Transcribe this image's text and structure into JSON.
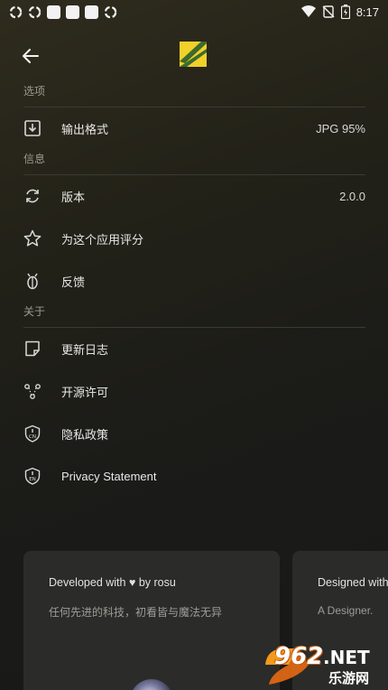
{
  "status_bar": {
    "time": "8:17",
    "left_icons": [
      "sync-icon",
      "sync-icon",
      "app-notification-icon",
      "app-notification-icon",
      "app-notification-icon",
      "sync-icon"
    ],
    "right_icons": [
      "wifi-icon",
      "no-sim-icon",
      "battery-icon"
    ]
  },
  "toolbar": {
    "back_icon": "arrow-left-icon",
    "logo_icon": "app-logo-icon"
  },
  "sections": {
    "options": "选项",
    "info": "信息",
    "about": "关于"
  },
  "rows": {
    "output_format": {
      "label": "输出格式",
      "value": "JPG 95%",
      "icon": "download-box-icon"
    },
    "version": {
      "label": "版本",
      "value": "2.0.0",
      "icon": "refresh-icon"
    },
    "rate_app": {
      "label": "为这个应用评分",
      "icon": "star-icon"
    },
    "feedback": {
      "label": "反馈",
      "icon": "bug-icon"
    },
    "changelog": {
      "label": "更新日志",
      "icon": "note-icon"
    },
    "open_source": {
      "label": "开源许可",
      "icon": "nodes-icon"
    },
    "privacy_cn": {
      "label": "隐私政策",
      "icon": "shield-cn-icon",
      "badge": "CN"
    },
    "privacy_en": {
      "label": "Privacy Statement",
      "icon": "shield-en-icon",
      "badge": "EN"
    }
  },
  "cards": [
    {
      "title": "Developed with ♥ by rosu",
      "subtitle": "任何先进的科技，初看皆与魔法无异"
    },
    {
      "title": "Designed with",
      "subtitle": "A Designer."
    }
  ],
  "watermark": {
    "brand": "962",
    "suffix": ".NET",
    "sub": "乐游网"
  },
  "colors": {
    "accent": "#f2d02a",
    "logo_green": "#3c6b2e",
    "background": "#1b1b18"
  }
}
